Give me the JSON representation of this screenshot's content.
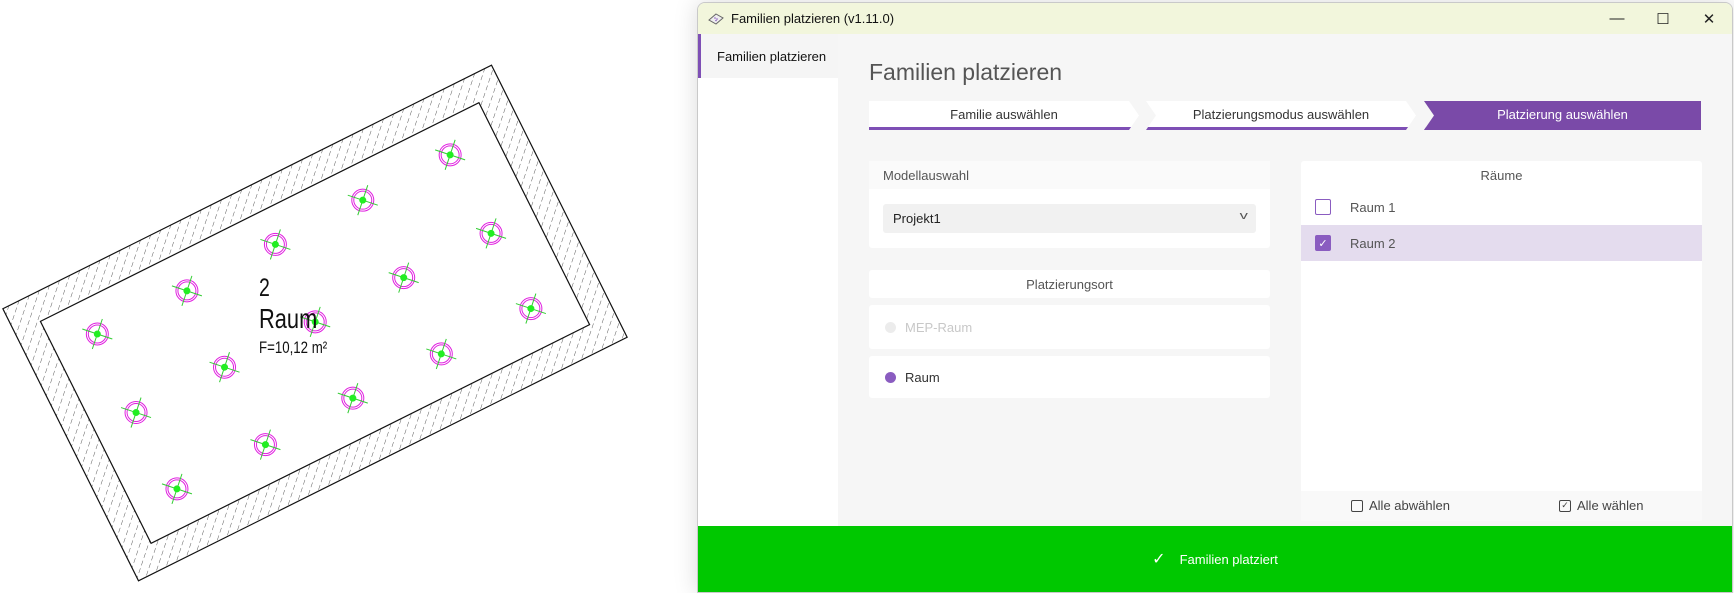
{
  "drawing": {
    "room_number": "2",
    "room_name": "Raum",
    "room_area": "F=10,12 m²"
  },
  "window": {
    "title": "Familien platzieren (v1.11.0)",
    "controls": {
      "minimize": "—",
      "maximize": "☐",
      "close": "✕"
    }
  },
  "sidebar": {
    "items": [
      {
        "label": "Familien platzieren",
        "selected": true
      }
    ]
  },
  "main": {
    "heading": "Familien platzieren",
    "steps": [
      {
        "label": "Familie auswählen",
        "state": "done"
      },
      {
        "label": "Platzierungsmodus auswählen",
        "state": "done"
      },
      {
        "label": "Platzierung auswählen",
        "state": "active"
      }
    ],
    "model_selection": {
      "header": "Modellauswahl",
      "selected": "Projekt1"
    },
    "placement_location": {
      "header": "Platzierungsort",
      "options": [
        {
          "label": "MEP-Raum",
          "selected": false,
          "disabled": true
        },
        {
          "label": "Raum",
          "selected": true,
          "disabled": false
        }
      ]
    },
    "rooms": {
      "header": "Räume",
      "items": [
        {
          "label": "Raum 1",
          "checked": false
        },
        {
          "label": "Raum 2",
          "checked": true
        }
      ],
      "deselect_all": "Alle abwählen",
      "select_all": "Alle wählen"
    },
    "status_bar": {
      "label": "Familien platziert",
      "icon": "check-icon"
    }
  },
  "colors": {
    "accent": "#7a4aa8",
    "success": "#00c800",
    "selected_row": "#e4dcee",
    "titlebar": "#f2f6dc"
  }
}
